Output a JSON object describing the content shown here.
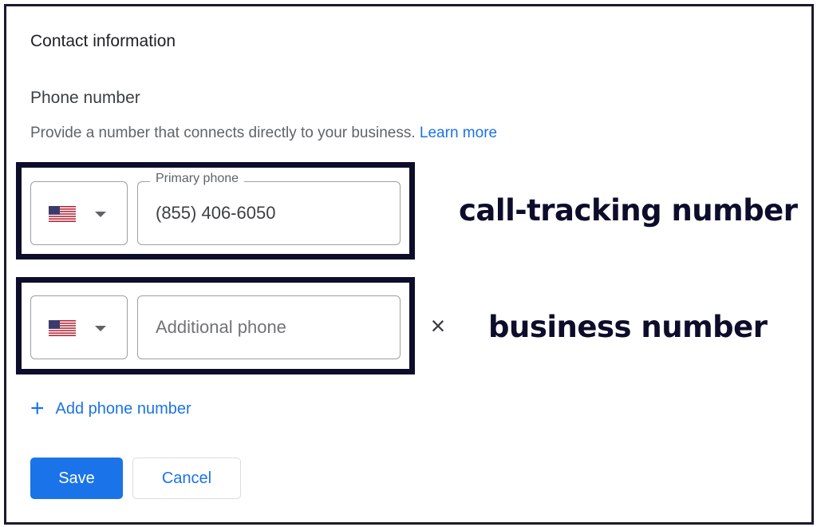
{
  "section": {
    "title": "Contact information",
    "subtitle": "Phone number",
    "description": "Provide a number that connects directly to your business.",
    "learn_more": "Learn more"
  },
  "primary_phone": {
    "country": "US",
    "label": "Primary phone",
    "value": "(855) 406-6050"
  },
  "additional_phone": {
    "country": "US",
    "placeholder": "Additional phone",
    "remove_icon": "close-icon"
  },
  "annotations": {
    "primary": "call-tracking number",
    "additional": "business number",
    "highlight_color": "#0d0d2b"
  },
  "actions": {
    "add_phone": "Add phone number",
    "save": "Save",
    "cancel": "Cancel"
  },
  "colors": {
    "accent": "#1a73e8",
    "text_primary": "#202124",
    "text_secondary": "#5f6368"
  }
}
